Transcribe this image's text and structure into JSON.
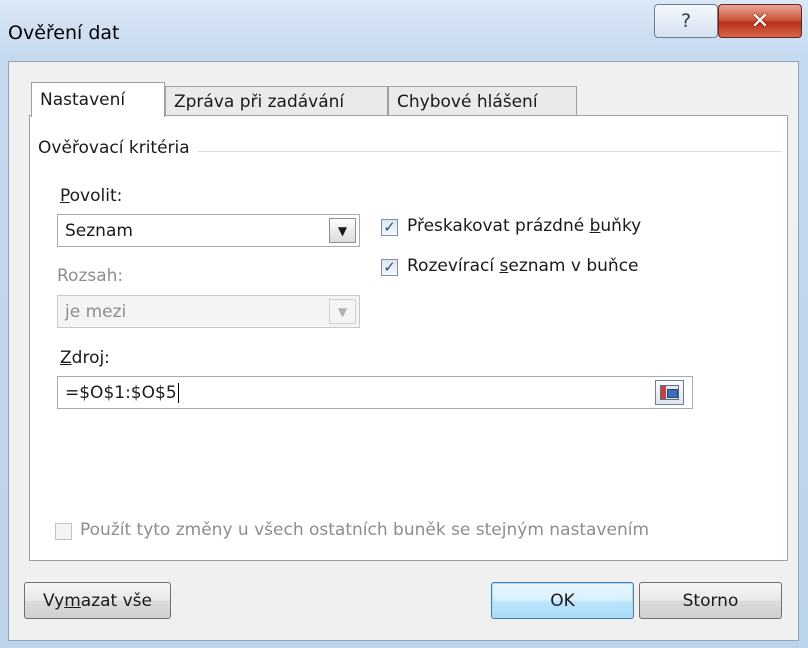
{
  "window": {
    "title": "Ověření dat",
    "help_glyph": "?",
    "close_glyph": "✕"
  },
  "tabs": [
    {
      "label": "Nastavení",
      "active": true
    },
    {
      "label": "Zpráva při zadávání",
      "active": false
    },
    {
      "label": "Chybové hlášení",
      "active": false
    }
  ],
  "criteria": {
    "group_title": "Ověřovací kritéria",
    "allow_label_u": "P",
    "allow_label_rest": "ovolit:",
    "allow_value": "Seznam",
    "range_label": "Rozsah:",
    "range_value": "je mezi",
    "source_label_u": "Z",
    "source_label_rest": "droj:",
    "source_value": "=$O$1:$O$5"
  },
  "checkboxes": {
    "ignore_blank": {
      "pre": "Přeskakovat prázdné ",
      "u": "b",
      "post": "uňky",
      "checked": true
    },
    "in_cell_dropdown": {
      "pre": "Rozevírací ",
      "u": "s",
      "post": "eznam v buňce",
      "checked": true
    },
    "apply_all": {
      "label": "Použít tyto změny u všech ostatních buněk se stejným nastavením",
      "checked": false
    }
  },
  "buttons": {
    "clear_pre": "Vy",
    "clear_u": "m",
    "clear_post": "azat vše",
    "ok": "OK",
    "cancel": "Storno"
  },
  "colors": {
    "close_button": "#c9452a",
    "checkmark": "#2d4f86"
  },
  "icons": {
    "dropdown": "▼",
    "check": "✓"
  }
}
